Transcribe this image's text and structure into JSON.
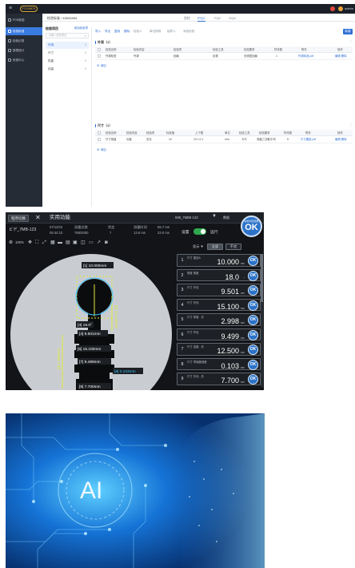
{
  "panel1": {
    "logo_text": "FOXMES",
    "user_text": "admin",
    "sidebar": {
      "items": [
        {
          "label": "PCB检验"
        },
        {
          "label": "检验标准"
        },
        {
          "label": "检验记录"
        },
        {
          "label": "报表统计"
        },
        {
          "label": "系统中心"
        }
      ]
    },
    "breadcrumb": "检验标准 / 43543454",
    "tabs": [
      "首检",
      "IPQC",
      "FQC",
      "OQA"
    ],
    "tree": {
      "title": "检验项目",
      "link": "添加检验项",
      "search_placeholder": "请输入检验项目",
      "items": [
        {
          "label": "外观",
          "count": "2"
        },
        {
          "label": "尺寸",
          "count": "0"
        },
        {
          "label": "性能",
          "count": "0"
        },
        {
          "label": "包装",
          "count": "0"
        }
      ]
    },
    "toolbar": [
      "导入",
      "导出",
      "复制",
      "删除",
      "检验人",
      "单位换算",
      "抽样人",
      "添加检验"
    ],
    "add_button": "新增",
    "section1": {
      "title": "外观（1）",
      "headers": [
        "检验名称",
        "检验内容",
        "检验项",
        "检验工具",
        "检验要求",
        "样本数",
        "附件",
        "操作"
      ],
      "row": [
        "外观检查",
        "外观",
        "划痕",
        "目视",
        "无明显划痕",
        "1",
        "外观标准.pdf",
        "编辑  删除"
      ],
      "add_label": "添加"
    },
    "section2": {
      "title": "尺寸（1）",
      "headers": [
        "检验名称",
        "检验内容",
        "检验项",
        "标准值",
        "上下限",
        "单位",
        "检验工具",
        "检验要求",
        "样本数",
        "附件",
        "操作"
      ],
      "row": [
        "尺寸测量",
        "长度",
        "总长",
        "10",
        "10 ± 0.1",
        "mm",
        "卡尺",
        "测量三次取平均",
        "5",
        "尺寸图纸.pdf",
        "编辑  删除"
      ],
      "add_label": "添加"
    }
  },
  "panel2": {
    "app_button": "程序切换",
    "app_title": "实用功能",
    "device_id": "IM8_7MB0-123",
    "signal_label": "▼",
    "battery_label": "数据",
    "info": {
      "prog_id": "ビデ_7MB-123",
      "date": "07/11/03",
      "time": "05:44:10",
      "count_label": "测量总数",
      "count_value": "768/2000",
      "judge_label": "判定",
      "judge_value": "7",
      "eff_label": "测量时间",
      "eff_value": "13.6 ms",
      "pos_label": "55.7 ms",
      "pos_value": "23.0 ms"
    },
    "switch_label": "设置",
    "switch_state": "运行",
    "ok_big": {
      "small": "综合判定结果",
      "text": "OK"
    },
    "zoom": "100%",
    "sort_label": "显示 ▼",
    "filters": [
      "全部",
      "不良"
    ],
    "labels": [
      "[1] 10.000mm",
      "[2] 15.100mm",
      "[3] 18.0°",
      "[4] 9.501mm",
      "[5] 15.100mm",
      "[6] 2.998mm",
      "[7] 9.499mm",
      "[8] 0.103mm",
      "[9] 7.700mm"
    ],
    "results": [
      {
        "idx": "1",
        "name": "尺寸 直径A",
        "value": "10.000",
        "unit": "mm",
        "status": "OK"
      },
      {
        "idx": "2",
        "name": "角度 角度",
        "value": "18.0",
        "unit": "°",
        "status": "OK"
      },
      {
        "idx": "3",
        "name": "尺寸 外径",
        "value": "9.501",
        "unit": "mm",
        "status": "OK"
      },
      {
        "idx": "4",
        "name": "尺寸 外径",
        "value": "15.100",
        "unit": "mm",
        "status": "OK"
      },
      {
        "idx": "5",
        "name": "尺寸 厚度 - 总",
        "value": "2.998",
        "unit": "mm",
        "status": "OK"
      },
      {
        "idx": "6",
        "name": "尺寸 外径",
        "value": "9.499",
        "unit": "mm",
        "status": "OK"
      },
      {
        "idx": "7",
        "name": "尺寸 高度 - 总",
        "value": "12.500",
        "unit": "mm",
        "status": "OK"
      },
      {
        "idx": "8",
        "name": "尺寸 同轴度误差",
        "value": "0.103",
        "unit": "mm",
        "status": "OK"
      },
      {
        "idx": "9",
        "name": "尺寸 外径 - 总",
        "value": "7.700",
        "unit": "mm",
        "status": "OK"
      }
    ]
  },
  "panel3": {
    "ai_text": "AI"
  },
  "colors": {
    "accent_blue": "#2f6fd6",
    "ok_blue": "#2c73c8",
    "switch_green": "#2fa84f",
    "sidebar_dark": "#262c35",
    "device_dark": "#121418"
  }
}
